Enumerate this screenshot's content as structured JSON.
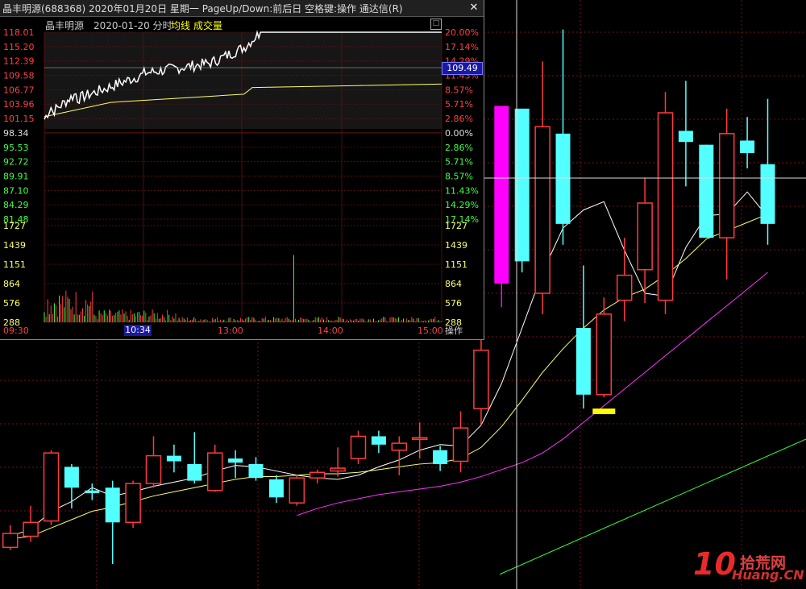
{
  "window": {
    "title": "晶丰明源(688368)  2020年01月20日  星期一  PageUp/Down:前后日  空格键:操作  通达信(R)",
    "close_glyph": "✕"
  },
  "subheader": {
    "stock_name": "晶丰明源",
    "date_mode": "2020-01-20 分时",
    "avg_label": "均线",
    "vol_label": "成交量",
    "maximize_glyph": "□"
  },
  "price_axis_left": [
    "118.01",
    "115.20",
    "112.39",
    "109.58",
    "106.77",
    "103.96",
    "101.15",
    "98.34",
    "95.53",
    "92.72",
    "89.91",
    "87.10",
    "84.29",
    "81.48"
  ],
  "pct_axis_right": [
    "20.00%",
    "17.14%",
    "14.29%",
    "11.43%",
    "8.57%",
    "5.71%",
    "2.86%",
    "0.00%",
    "2.86%",
    "5.71%",
    "8.57%",
    "11.43%",
    "14.29%",
    "17.14%"
  ],
  "volume_axis": [
    "1727",
    "1439",
    "1151",
    "864",
    "576",
    "288"
  ],
  "time_axis": [
    "09:30",
    "13:00",
    "14:00",
    "15:00"
  ],
  "cursor": {
    "price": "109.49",
    "time": "10:34"
  },
  "operate_label": "操作",
  "watermark": {
    "num": "10",
    "cn": "拾荒网",
    "en": "Huang.CN"
  },
  "colors": {
    "up": "#ff3b3b",
    "down": "#54ffff",
    "magenta": "#ff00ff",
    "yellow": "#ffff00",
    "ma5": "#ffffff",
    "ma10": "#ffff66",
    "ma20": "#ff33ff",
    "ma60": "#33ff33",
    "grid": "#7a1010"
  },
  "chart_data": {
    "type": "candlestick",
    "candles": [
      {
        "o": 0.2,
        "c": 1.2,
        "h": 1.8,
        "l": 0.0
      },
      {
        "o": 1.0,
        "c": 2.0,
        "h": 3.2,
        "l": 0.6
      },
      {
        "o": 2.1,
        "c": 7.0,
        "h": 7.2,
        "l": 1.8
      },
      {
        "o": 6.0,
        "c": 4.5,
        "h": 6.2,
        "l": 3.0
      },
      {
        "o": 4.3,
        "c": 4.1,
        "h": 4.8,
        "l": 3.6
      },
      {
        "o": 4.5,
        "c": 2.0,
        "h": 5.0,
        "l": -1.0
      },
      {
        "o": 2.0,
        "c": 4.8,
        "h": 5.0,
        "l": 1.6
      },
      {
        "o": 4.8,
        "c": 6.8,
        "h": 8.2,
        "l": 4.5
      },
      {
        "o": 6.8,
        "c": 6.4,
        "h": 7.6,
        "l": 5.6
      },
      {
        "o": 6.2,
        "c": 5.0,
        "h": 8.5,
        "l": 4.8
      },
      {
        "o": 4.3,
        "c": 7.0,
        "h": 7.6,
        "l": 4.2
      },
      {
        "o": 6.6,
        "c": 6.3,
        "h": 7.2,
        "l": 5.2
      },
      {
        "o": 6.2,
        "c": 5.2,
        "h": 6.7,
        "l": 5.0
      },
      {
        "o": 5.1,
        "c": 3.8,
        "h": 5.4,
        "l": 3.4
      },
      {
        "o": 3.4,
        "c": 5.2,
        "h": 5.4,
        "l": 3.2
      },
      {
        "o": 5.2,
        "c": 5.6,
        "h": 5.8,
        "l": 4.8
      },
      {
        "o": 5.7,
        "c": 5.9,
        "h": 7.4,
        "l": 5.3
      },
      {
        "o": 6.6,
        "c": 8.2,
        "h": 8.6,
        "l": 6.2
      },
      {
        "o": 8.2,
        "c": 7.6,
        "h": 8.6,
        "l": 7.0
      },
      {
        "o": 7.2,
        "c": 7.7,
        "h": 8.2,
        "l": 5.4
      },
      {
        "o": 8.1,
        "c": 8.1,
        "h": 9.2,
        "l": 6.6
      },
      {
        "o": 7.2,
        "c": 6.2,
        "h": 7.5,
        "l": 5.7
      },
      {
        "o": 6.4,
        "c": 8.8,
        "h": 10.0,
        "l": 5.6
      },
      {
        "o": 10.2,
        "c": 14.4,
        "h": 16.0,
        "l": 9.0
      },
      {
        "o": 19.2,
        "c": 32.0,
        "h": 32.0,
        "l": 17.5
      },
      {
        "o": 31.8,
        "c": 20.8,
        "h": 31.8,
        "l": 20.0
      },
      {
        "o": 18.5,
        "c": 30.5,
        "h": 35.2,
        "l": 17.0
      },
      {
        "o": 30.0,
        "c": 23.5,
        "h": 37.5,
        "l": 22.0
      },
      {
        "o": 16.0,
        "c": 11.2,
        "h": 20.5,
        "l": 10.2
      },
      {
        "o": 11.2,
        "c": 17.0,
        "h": 18.2,
        "l": 11.0
      },
      {
        "o": 18.0,
        "c": 19.8,
        "h": 22.5,
        "l": 16.5
      },
      {
        "o": 20.2,
        "c": 25.0,
        "h": 26.8,
        "l": 17.8
      },
      {
        "o": 18.0,
        "c": 31.5,
        "h": 33.0,
        "l": 17.0
      },
      {
        "o": 30.2,
        "c": 29.4,
        "h": 33.8,
        "l": 26.2
      },
      {
        "o": 29.2,
        "c": 22.5,
        "h": 29.2,
        "l": 22.5
      },
      {
        "o": 22.5,
        "c": 30.0,
        "h": 31.8,
        "l": 19.5
      },
      {
        "o": 29.5,
        "c": 28.6,
        "h": 31.2,
        "l": 27.5
      },
      {
        "o": 27.8,
        "c": 23.5,
        "h": 32.5,
        "l": 22.0
      }
    ],
    "ma5": [
      1.0,
      1.5,
      2.8,
      3.5,
      4.5,
      3.9,
      4.2,
      4.6,
      4.9,
      5.2,
      5.7,
      6.1,
      6.0,
      5.7,
      5.4,
      5.2,
      5.1,
      5.4,
      6.0,
      6.5,
      7.2,
      7.6,
      7.5,
      9.0,
      12.0,
      16.0,
      20.0,
      23.2,
      24.5,
      25.1,
      21.6,
      18.5,
      18.3,
      21.8,
      24.1,
      24.2,
      25.8,
      24.0
    ],
    "ma10": [
      0.8,
      1.0,
      1.6,
      2.2,
      2.8,
      3.1,
      3.5,
      3.9,
      4.2,
      4.5,
      4.8,
      5.1,
      5.3,
      5.3,
      5.4,
      5.5,
      5.5,
      5.6,
      5.8,
      6.0,
      6.2,
      6.3,
      6.6,
      7.4,
      8.9,
      10.8,
      12.8,
      14.5,
      16.0,
      17.3,
      18.2,
      18.8,
      19.8,
      21.0,
      22.4,
      23.0,
      23.6,
      24.2
    ],
    "ma20_segment": [
      2.5,
      3.0,
      3.4,
      3.7,
      4.0,
      4.2,
      4.4,
      4.6,
      4.9,
      5.3,
      5.8,
      6.3,
      7.0,
      8.0,
      9.2,
      10.4,
      11.6,
      12.8,
      14.0,
      15.2,
      16.4,
      17.6,
      18.8,
      20.0
    ],
    "ma60_range": [
      0.0,
      8.0
    ],
    "intraday_price_range": [
      81.48,
      118.01
    ],
    "prev_close": 98.34,
    "volume_max": 1727
  }
}
